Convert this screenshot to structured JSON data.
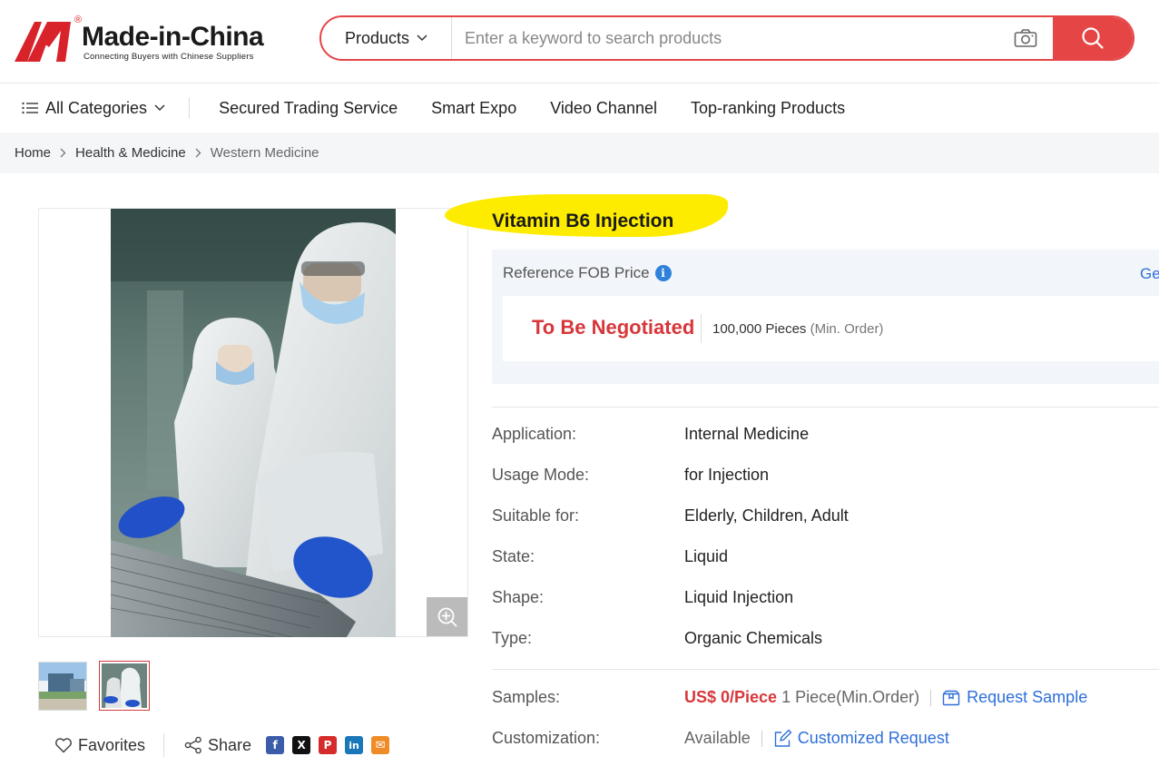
{
  "brand": {
    "name": "Made-in-China",
    "tagline": "Connecting Buyers with Chinese Suppliers",
    "reg": "®"
  },
  "search": {
    "category": "Products",
    "placeholder": "Enter a keyword to search products"
  },
  "nav": {
    "all_categories": "All Categories",
    "items": [
      "Secured Trading Service",
      "Smart Expo",
      "Video Channel",
      "Top-ranking Products"
    ]
  },
  "breadcrumb": [
    "Home",
    "Health & Medicine",
    "Western Medicine"
  ],
  "product": {
    "title": "Vitamin B6 Injection",
    "price_label": "Reference FOB Price",
    "price_link": "Ge",
    "price": "To Be Negotiated",
    "moq_qty": "100,000 Pieces",
    "moq_note": "(Min. Order)"
  },
  "specs": [
    {
      "key": "Application:",
      "value": "Internal Medicine"
    },
    {
      "key": "Usage Mode:",
      "value": "for Injection"
    },
    {
      "key": "Suitable for:",
      "value": "Elderly, Children, Adult"
    },
    {
      "key": "State:",
      "value": "Liquid"
    },
    {
      "key": "Shape:",
      "value": "Liquid Injection"
    },
    {
      "key": "Type:",
      "value": "Organic Chemicals"
    }
  ],
  "samples": {
    "key": "Samples:",
    "price": "US$ 0/Piece",
    "min": "1 Piece(Min.Order)",
    "link": "Request Sample"
  },
  "customization": {
    "key": "Customization:",
    "status": "Available",
    "link": "Customized Request"
  },
  "actions": {
    "favorites": "Favorites",
    "share": "Share"
  },
  "socials": [
    {
      "name": "facebook",
      "glyph": "f",
      "color": "#3b5ca8"
    },
    {
      "name": "x",
      "glyph": "X",
      "color": "#111111"
    },
    {
      "name": "pinterest",
      "glyph": "P",
      "color": "#d62b2b"
    },
    {
      "name": "linkedin",
      "glyph": "in",
      "color": "#1a78b8"
    },
    {
      "name": "email",
      "glyph": "✉",
      "color": "#f08c28"
    }
  ],
  "colors": {
    "brand_red": "#e64545",
    "price_red": "#d7373a",
    "link_blue": "#2e6fd9",
    "highlight": "#fdec00"
  }
}
